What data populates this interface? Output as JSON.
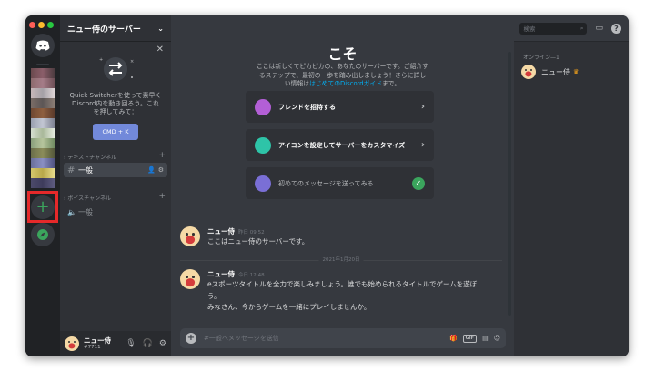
{
  "server": {
    "name": "ニュー侍のサーバー"
  },
  "sidebar": {
    "quick_switcher": {
      "text": "Quick Switcherを使って素早くDiscord内を動き回ろう。これを押してみて：",
      "shortcut": "CMD + K"
    },
    "categories": [
      {
        "name": "テキストチャンネル",
        "channels": [
          {
            "name": "一般",
            "active": true
          }
        ]
      },
      {
        "name": "ボイスチャンネル",
        "channels": [
          {
            "name": "一般",
            "active": false
          }
        ]
      }
    ]
  },
  "user_panel": {
    "name": "ニュー侍",
    "tag": "#7711"
  },
  "header": {
    "channel": "一般",
    "search_placeholder": "検索"
  },
  "welcome": {
    "heading": "こそ",
    "desc_pre": "ここは新しくてピカピカの、あなたのサーバーです。ご紹介するステップで、最初の一歩を踏み出しましょう！さらに詳しい情報は",
    "desc_link": "はじめてのDiscordガイド",
    "desc_post": "まで。",
    "tasks": [
      {
        "label": "フレンドを招待する",
        "done": false
      },
      {
        "label": "アイコンを設定してサーバーをカスタマイズ",
        "done": false
      },
      {
        "label": "初めてのメッセージを送ってみる",
        "done": true
      }
    ]
  },
  "messages": [
    {
      "author": "ニュー侍",
      "time": "昨日 09:52",
      "lines": [
        "ここはニュー侍のサーバーです。"
      ]
    },
    {
      "author": "ニュー侍",
      "time": "今日 12:48",
      "lines": [
        "eスポーツタイトルを全力で楽しみましょう。誰でも始められるタイトルでゲームを遊ぼう。",
        "みなさん、今からゲームを一緒にプレイしませんか。"
      ]
    }
  ],
  "date_divider": "2021年1月20日",
  "composer": {
    "placeholder": "#一般へメッセージを送信"
  },
  "members": {
    "group": "オンライン—1",
    "list": [
      {
        "name": "ニュー侍",
        "owner": true
      }
    ]
  },
  "colors": {
    "accent": "#7289da",
    "green": "#3ba55d",
    "highlight": "#e5292a",
    "link": "#00b0f4"
  }
}
